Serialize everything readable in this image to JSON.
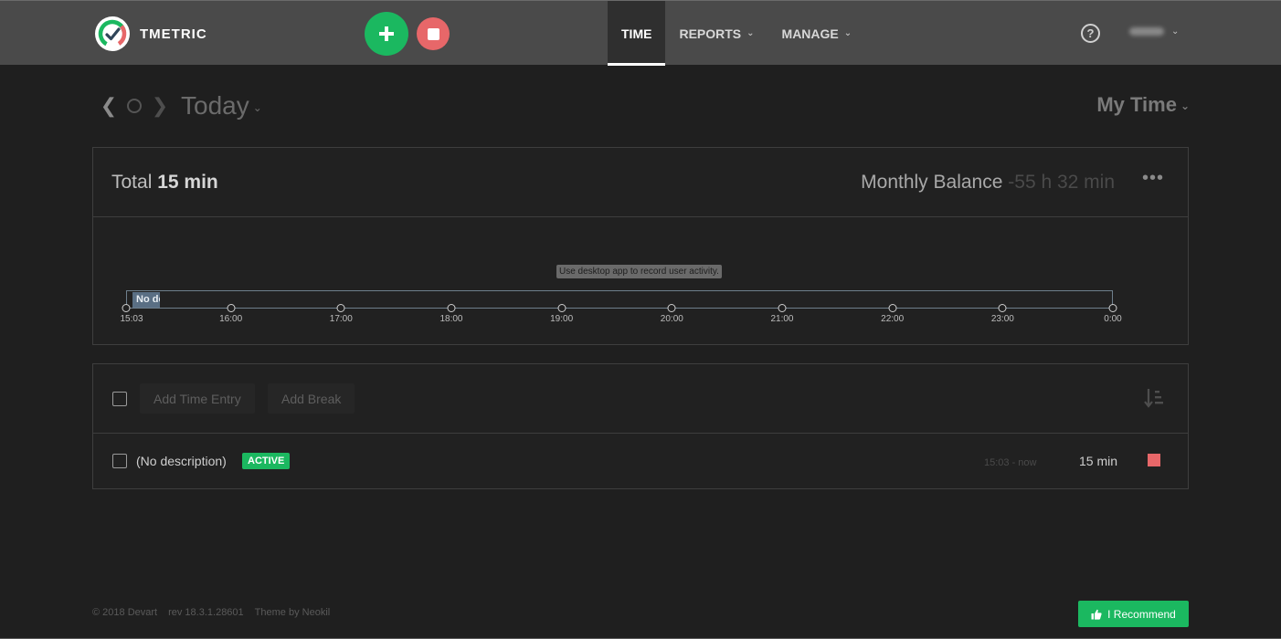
{
  "app": {
    "name": "TMETRIC"
  },
  "nav": [
    {
      "label": "TIME",
      "active": true,
      "dropdown": false
    },
    {
      "label": "REPORTS",
      "active": false,
      "dropdown": true
    },
    {
      "label": "MANAGE",
      "active": false,
      "dropdown": true
    }
  ],
  "header": {
    "help_glyph": "?",
    "user_name_blurred": true
  },
  "date_nav": {
    "label": "Today",
    "scope": "My Time"
  },
  "summary": {
    "total_prefix": "Total",
    "total_value": "15 min",
    "balance_label": "Monthly Balance",
    "balance_value": "-55 h 32 min"
  },
  "timeline": {
    "tooltip": "Use desktop app to record user activity.",
    "entry_label": "No description",
    "ticks": [
      "15:03",
      "16:00",
      "17:00",
      "18:00",
      "19:00",
      "20:00",
      "21:00",
      "22:00",
      "23:00",
      "0:00"
    ]
  },
  "toolbar": {
    "add_entry": "Add Time Entry",
    "add_break": "Add Break"
  },
  "entries": [
    {
      "description": "(No description)",
      "badge": "ACTIVE",
      "range": "15:03 - now",
      "duration": "15 min"
    }
  ],
  "footer": {
    "copyright": "© 2018 Devart",
    "revision": "rev 18.3.1.28601",
    "theme": "Theme by Neokil",
    "recommend": "I Recommend"
  },
  "colors": {
    "accent_green": "#1bb860",
    "stop_red": "#e76769",
    "topbar": "#4a4a4a",
    "background": "#1f1f1f"
  },
  "icons": [
    "logo-icon",
    "plus-icon",
    "stop-icon",
    "help-icon",
    "chevron-down-icon",
    "chevron-left-icon",
    "chevron-right-icon",
    "circle-icon",
    "more-icon",
    "sort-icon",
    "thumbs-up-icon"
  ]
}
